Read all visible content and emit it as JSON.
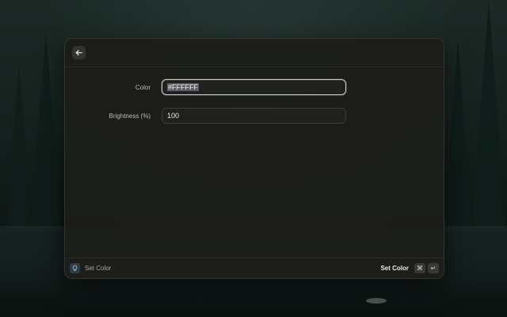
{
  "form": {
    "fields": [
      {
        "label": "Color",
        "value": "#FFFFFF",
        "focused": true
      },
      {
        "label": "Brightness (%)",
        "value": "100",
        "focused": false
      }
    ]
  },
  "footer": {
    "title": "Set Color",
    "action_label": "Set Color",
    "shortcut_keys": [
      "⌘",
      "↵"
    ]
  },
  "icons": {
    "back": "arrow-left-icon",
    "extension": "lightbulb-icon"
  },
  "colors": {
    "window_bg": "#1c1d19",
    "focus_ring": "#cfcfca",
    "selection": "#5b5d64"
  }
}
